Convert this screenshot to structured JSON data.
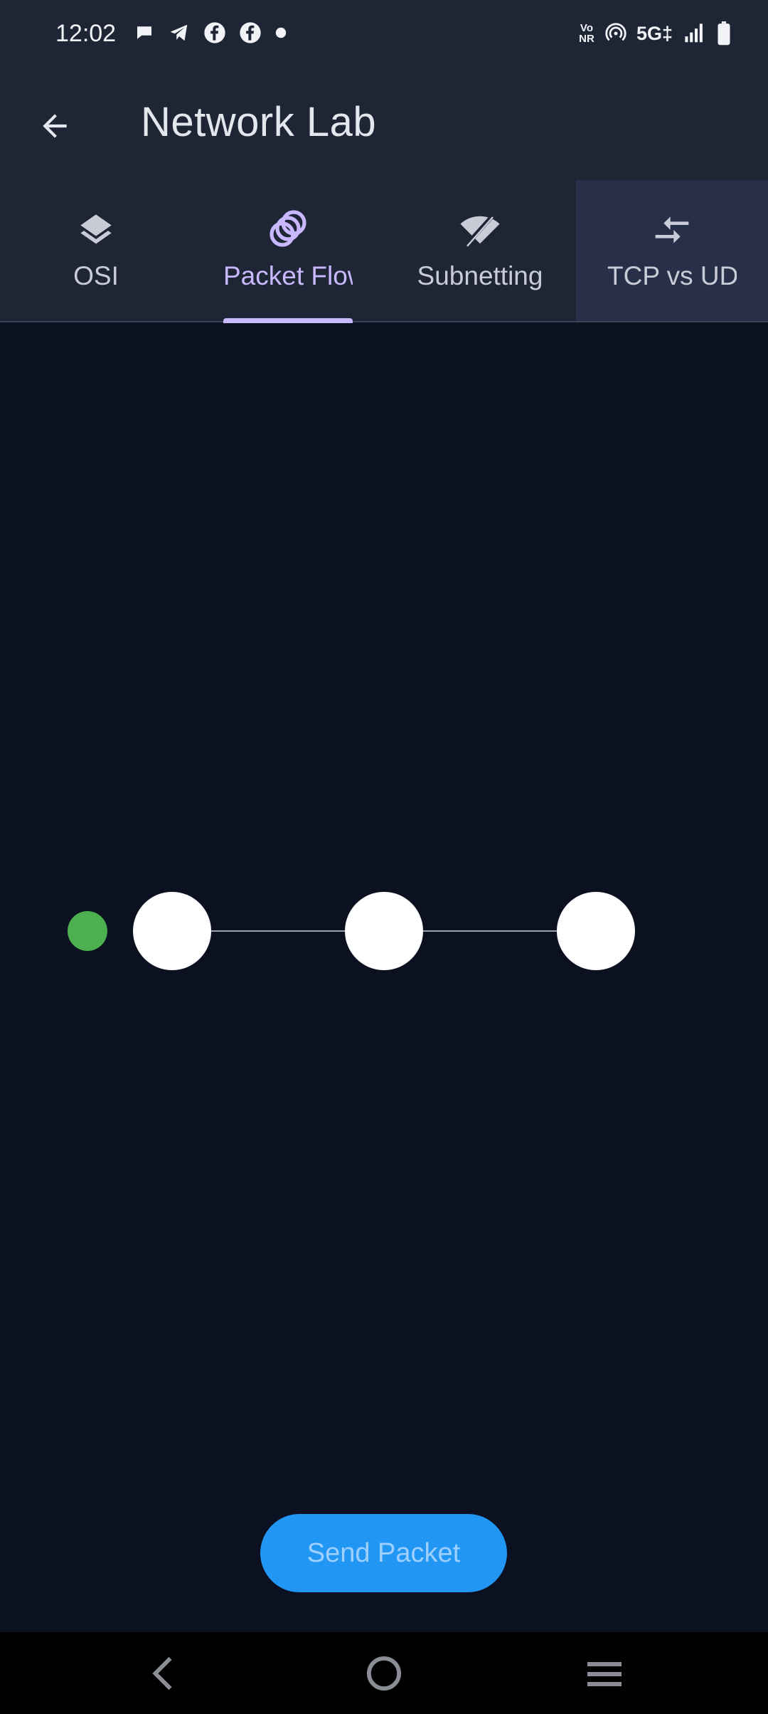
{
  "status_bar": {
    "time": "12:02",
    "left_icons": [
      "chat-bubble-icon",
      "telegram-icon",
      "facebook-icon",
      "facebook-icon",
      "dot-icon"
    ],
    "right_icons": [
      "vonr-icon",
      "hotspot-icon",
      "5g-icon",
      "signal-icon",
      "battery-icon"
    ],
    "vonr_text": "Vo NR",
    "network_text": "5G‡"
  },
  "app_bar": {
    "title": "Network Lab",
    "back_icon": "arrow-back-icon"
  },
  "tabs": [
    {
      "label": "OSI",
      "icon": "layers-icon",
      "active": false
    },
    {
      "label": "Packet Flow",
      "icon": "rings-icon",
      "active": true
    },
    {
      "label": "Subnetting",
      "icon": "wifi-off-icon",
      "active": false
    },
    {
      "label": "TCP vs UDP",
      "icon": "compare-arrows-icon",
      "active": false
    }
  ],
  "packet_flow": {
    "packet_progress": 0,
    "nodes": 3,
    "packet_color": "#4caf50",
    "node_color": "#ffffff",
    "link_color": "#9aa0ab"
  },
  "send_button": {
    "label": "Send Packet",
    "color": "#2196f3"
  },
  "nav_bar": {
    "buttons": [
      "back-nav-icon",
      "home-nav-icon",
      "recents-nav-icon"
    ]
  },
  "colors": {
    "background": "#0b1120",
    "app_bar": "#1e2535",
    "accent": "#c9b8ff"
  }
}
